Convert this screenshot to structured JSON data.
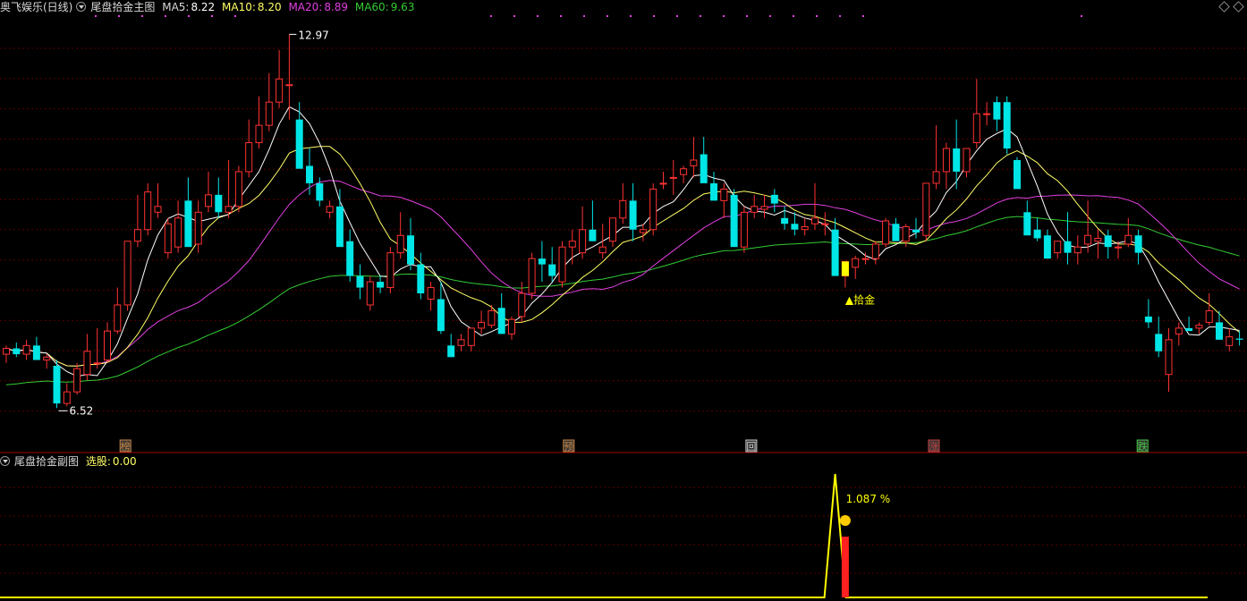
{
  "main_header": {
    "stock": "奥飞娱乐(日线)",
    "indicator": "尾盘拾金主图",
    "ma5_label": "MA5:",
    "ma5_value": "8.22",
    "ma10_label": "MA10:",
    "ma10_value": "8.20",
    "ma20_label": "MA20:",
    "ma20_value": "8.89",
    "ma60_label": "MA60:",
    "ma60_value": "9.63"
  },
  "sub_header": {
    "indicator": "尾盘拾金副图",
    "select_label": "选股:",
    "select_value": "0.00"
  },
  "colors": {
    "up": "#ff3232",
    "down": "#00e5e5",
    "ma5": "#ffffff",
    "ma10": "#ffff66",
    "ma20": "#e040e0",
    "ma60": "#33cc33",
    "grid": "#5a0000",
    "signal": "#ffff00"
  },
  "chart_data": [
    {
      "type": "candlestick",
      "ylim": [
        6.0,
        13.3
      ],
      "max_label": "12.97",
      "min_label": "6.52",
      "signal_label": "▲拾金",
      "candles": [
        [
          7.45,
          7.6,
          7.3,
          7.55
        ],
        [
          7.55,
          7.65,
          7.4,
          7.45
        ],
        [
          7.45,
          7.7,
          7.35,
          7.6
        ],
        [
          7.6,
          7.75,
          7.4,
          7.35
        ],
        [
          7.35,
          7.45,
          7.2,
          7.4
        ],
        [
          7.25,
          7.35,
          6.52,
          6.6
        ],
        [
          6.6,
          6.95,
          6.55,
          6.8
        ],
        [
          6.8,
          7.3,
          6.75,
          7.2
        ],
        [
          7.1,
          7.8,
          7.0,
          7.5
        ],
        [
          7.3,
          7.9,
          7.2,
          7.3
        ],
        [
          7.35,
          8.0,
          7.3,
          7.85
        ],
        [
          7.85,
          8.6,
          7.8,
          8.3
        ],
        [
          8.3,
          9.4,
          8.2,
          9.4
        ],
        [
          9.4,
          10.2,
          9.3,
          9.6
        ],
        [
          9.6,
          10.4,
          9.5,
          10.25
        ],
        [
          9.9,
          10.4,
          9.8,
          10.0
        ],
        [
          9.2,
          9.8,
          9.1,
          9.7
        ],
        [
          9.3,
          10.1,
          9.2,
          9.8
        ],
        [
          10.1,
          10.5,
          9.3,
          9.3
        ],
        [
          9.35,
          10.1,
          9.2,
          9.9
        ],
        [
          10.0,
          10.6,
          9.9,
          10.2
        ],
        [
          10.2,
          10.5,
          9.8,
          9.9
        ],
        [
          9.9,
          10.8,
          9.8,
          10.0
        ],
        [
          10.0,
          10.7,
          9.9,
          10.6
        ],
        [
          10.6,
          11.5,
          10.5,
          11.1
        ],
        [
          11.1,
          11.9,
          11.0,
          11.4
        ],
        [
          11.4,
          12.3,
          11.3,
          11.8
        ],
        [
          11.8,
          12.7,
          11.7,
          12.2
        ],
        [
          12.1,
          12.97,
          11.5,
          12.1
        ],
        [
          11.5,
          11.8,
          11.0,
          10.65
        ],
        [
          10.7,
          11.0,
          10.2,
          10.4
        ],
        [
          10.4,
          10.5,
          10.0,
          10.1
        ],
        [
          9.9,
          10.1,
          9.8,
          10.0
        ],
        [
          10.0,
          10.3,
          9.5,
          9.3
        ],
        [
          9.4,
          9.6,
          8.7,
          8.8
        ],
        [
          8.8,
          9.0,
          8.4,
          8.6
        ],
        [
          8.3,
          8.8,
          8.2,
          8.7
        ],
        [
          8.7,
          8.8,
          8.5,
          8.6
        ],
        [
          8.6,
          9.3,
          8.5,
          9.2
        ],
        [
          9.2,
          9.9,
          9.1,
          9.5
        ],
        [
          9.5,
          9.8,
          8.9,
          9.0
        ],
        [
          9.0,
          9.2,
          8.4,
          8.5
        ],
        [
          8.4,
          8.7,
          8.2,
          8.6
        ],
        [
          8.4,
          8.7,
          7.8,
          7.85
        ],
        [
          7.6,
          7.8,
          7.4,
          7.4
        ],
        [
          7.6,
          7.8,
          7.5,
          7.7
        ],
        [
          7.6,
          7.9,
          7.5,
          7.9
        ],
        [
          7.9,
          8.2,
          7.8,
          8.0
        ],
        [
          7.95,
          8.3,
          7.9,
          8.2
        ],
        [
          8.25,
          8.5,
          7.8,
          7.8
        ],
        [
          7.8,
          8.1,
          7.7,
          8.05
        ],
        [
          8.1,
          8.7,
          8.0,
          8.5
        ],
        [
          8.5,
          9.2,
          8.4,
          9.1
        ],
        [
          9.1,
          9.4,
          8.7,
          9.0
        ],
        [
          9.0,
          9.3,
          8.7,
          8.8
        ],
        [
          8.7,
          9.4,
          8.6,
          9.3
        ],
        [
          9.3,
          9.6,
          9.0,
          9.4
        ],
        [
          9.2,
          10.0,
          9.1,
          9.6
        ],
        [
          9.6,
          10.1,
          9.4,
          9.4
        ],
        [
          9.2,
          9.7,
          9.1,
          9.3
        ],
        [
          9.4,
          9.8,
          9.3,
          9.8
        ],
        [
          9.8,
          10.4,
          9.7,
          10.1
        ],
        [
          10.1,
          10.4,
          9.4,
          9.6
        ],
        [
          9.55,
          9.7,
          9.4,
          9.6
        ],
        [
          9.6,
          10.4,
          9.5,
          10.3
        ],
        [
          10.4,
          10.6,
          10.3,
          10.4
        ],
        [
          10.5,
          10.8,
          10.2,
          10.5
        ],
        [
          10.55,
          10.7,
          10.4,
          10.65
        ],
        [
          10.7,
          11.2,
          10.5,
          10.8
        ],
        [
          10.9,
          11.2,
          10.5,
          10.4
        ],
        [
          10.4,
          10.6,
          10.1,
          10.1
        ],
        [
          10.1,
          10.4,
          9.8,
          10.3
        ],
        [
          10.2,
          10.3,
          9.5,
          9.3
        ],
        [
          9.3,
          10.0,
          9.2,
          9.9
        ],
        [
          9.9,
          10.2,
          9.8,
          10.0
        ],
        [
          9.95,
          10.2,
          9.8,
          10.0
        ],
        [
          10.2,
          10.3,
          9.9,
          10.05
        ],
        [
          9.8,
          10.0,
          9.6,
          9.7
        ],
        [
          9.7,
          9.9,
          9.5,
          9.6
        ],
        [
          9.6,
          9.8,
          9.5,
          9.65
        ],
        [
          9.7,
          10.4,
          9.6,
          9.8
        ],
        [
          9.7,
          9.9,
          9.5,
          9.7
        ],
        [
          9.6,
          9.8,
          8.8,
          8.8
        ],
        [
          8.8,
          9.05,
          8.6,
          9.05
        ],
        [
          8.95,
          9.15,
          8.75,
          9.1
        ],
        [
          9.1,
          9.2,
          9.0,
          9.1
        ],
        [
          9.1,
          9.4,
          9.0,
          9.35
        ],
        [
          9.35,
          9.8,
          9.3,
          9.75
        ],
        [
          9.7,
          9.8,
          9.4,
          9.4
        ],
        [
          9.4,
          9.7,
          9.3,
          9.65
        ],
        [
          9.6,
          9.8,
          9.45,
          9.55
        ],
        [
          9.5,
          10.4,
          9.4,
          10.4
        ],
        [
          10.4,
          11.4,
          10.3,
          10.6
        ],
        [
          10.6,
          11.1,
          10.3,
          11.0
        ],
        [
          11.0,
          11.5,
          10.3,
          10.6
        ],
        [
          10.6,
          11.0,
          10.5,
          11.0
        ],
        [
          11.1,
          12.2,
          11.0,
          11.6
        ],
        [
          11.6,
          11.8,
          11.4,
          11.6
        ],
        [
          11.8,
          11.9,
          11.3,
          11.5
        ],
        [
          11.8,
          11.9,
          10.9,
          11.0
        ],
        [
          10.8,
          10.85,
          10.4,
          10.3
        ],
        [
          9.9,
          10.1,
          9.6,
          9.5
        ],
        [
          9.6,
          9.8,
          9.4,
          9.45
        ],
        [
          9.5,
          9.6,
          9.1,
          9.1
        ],
        [
          9.2,
          9.4,
          9.1,
          9.4
        ],
        [
          9.4,
          9.9,
          9.0,
          9.2
        ],
        [
          9.2,
          9.5,
          9.0,
          9.3
        ],
        [
          9.35,
          10.1,
          9.2,
          9.5
        ],
        [
          9.4,
          9.6,
          9.1,
          9.45
        ],
        [
          9.5,
          9.6,
          9.1,
          9.3
        ],
        [
          9.3,
          9.4,
          9.1,
          9.3
        ],
        [
          9.35,
          9.8,
          9.3,
          9.5
        ],
        [
          9.5,
          9.6,
          9.0,
          9.2
        ],
        [
          8.1,
          8.4,
          7.9,
          8.0
        ],
        [
          7.8,
          8.1,
          7.4,
          7.5
        ],
        [
          7.1,
          7.9,
          6.8,
          7.7
        ],
        [
          7.8,
          8.0,
          7.6,
          7.9
        ],
        [
          7.9,
          8.1,
          7.85,
          7.85
        ],
        [
          7.9,
          8.0,
          7.8,
          7.95
        ],
        [
          8.0,
          8.5,
          7.95,
          8.2
        ],
        [
          8.0,
          8.2,
          7.7,
          7.7
        ],
        [
          7.6,
          7.9,
          7.5,
          7.75
        ],
        [
          7.72,
          7.85,
          7.6,
          7.7
        ]
      ]
    },
    {
      "type": "line",
      "value_label": "1.087 %",
      "peak_index": 82,
      "bar_index": 83
    }
  ],
  "markers": [
    {
      "label": "榜",
      "index": 9
    },
    {
      "label": "预",
      "index": 43
    },
    {
      "label": "回",
      "index": 57
    },
    {
      "label": "涨",
      "index": 71
    },
    {
      "label": "跌",
      "index": 87
    }
  ]
}
